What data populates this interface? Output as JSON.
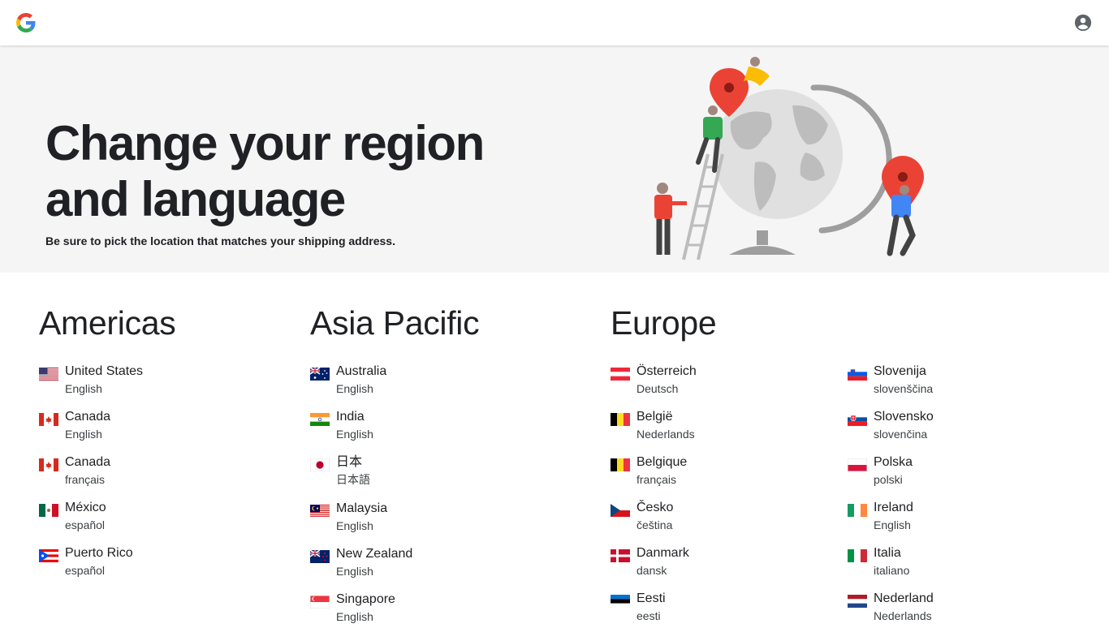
{
  "header": {
    "logo_icon": "google-g-logo",
    "account_icon": "account-circle-icon"
  },
  "hero": {
    "title_line1": "Change your region",
    "title_line2": "and language",
    "subtitle": "Be sure to pick the location that matches your shipping address."
  },
  "regions": {
    "americas": {
      "title": "Americas",
      "countries": [
        {
          "name": "United States",
          "language": "English",
          "flag": "us"
        },
        {
          "name": "Canada",
          "language": "English",
          "flag": "ca"
        },
        {
          "name": "Canada",
          "language": "français",
          "flag": "ca"
        },
        {
          "name": "México",
          "language": "español",
          "flag": "mx"
        },
        {
          "name": "Puerto Rico",
          "language": "español",
          "flag": "pr"
        }
      ]
    },
    "asia_pacific": {
      "title": "Asia Pacific",
      "countries": [
        {
          "name": "Australia",
          "language": "English",
          "flag": "au"
        },
        {
          "name": "India",
          "language": "English",
          "flag": "in"
        },
        {
          "name": "日本",
          "language": "日本語",
          "flag": "jp"
        },
        {
          "name": "Malaysia",
          "language": "English",
          "flag": "my"
        },
        {
          "name": "New Zealand",
          "language": "English",
          "flag": "nz"
        },
        {
          "name": "Singapore",
          "language": "English",
          "flag": "sg"
        }
      ]
    },
    "europe": {
      "title": "Europe",
      "countries": [
        {
          "name": "Österreich",
          "language": "Deutsch",
          "flag": "at"
        },
        {
          "name": "België",
          "language": "Nederlands",
          "flag": "be"
        },
        {
          "name": "Belgique",
          "language": "français",
          "flag": "be"
        },
        {
          "name": "Česko",
          "language": "čeština",
          "flag": "cz"
        },
        {
          "name": "Danmark",
          "language": "dansk",
          "flag": "dk"
        },
        {
          "name": "Eesti",
          "language": "eesti",
          "flag": "ee"
        },
        {
          "name": "Slovenija",
          "language": "slovenščina",
          "flag": "si"
        },
        {
          "name": "Slovensko",
          "language": "slovenčina",
          "flag": "sk"
        },
        {
          "name": "Polska",
          "language": "polski",
          "flag": "pl"
        },
        {
          "name": "Ireland",
          "language": "English",
          "flag": "ie"
        },
        {
          "name": "Italia",
          "language": "italiano",
          "flag": "it"
        },
        {
          "name": "Nederland",
          "language": "Nederlands",
          "flag": "nl"
        }
      ]
    }
  },
  "colors": {
    "hero_bg": "#f5f5f5",
    "text": "#202124",
    "pin_red": "#ea4335",
    "google_blue": "#4285f4"
  }
}
